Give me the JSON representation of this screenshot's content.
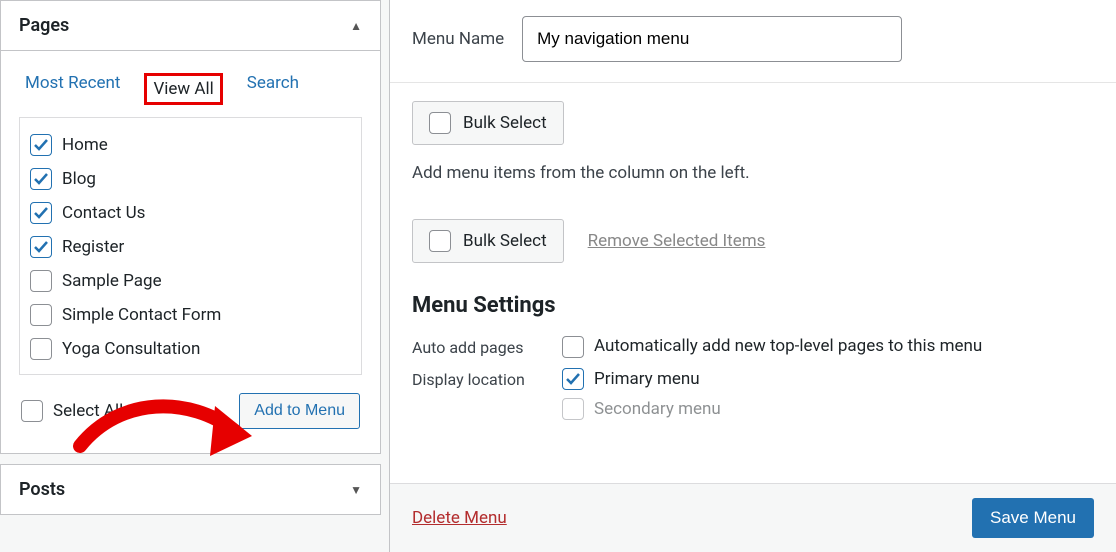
{
  "left": {
    "panels": {
      "pages": {
        "title": "Pages",
        "expanded": true
      },
      "posts": {
        "title": "Posts",
        "expanded": false
      }
    },
    "tabs": {
      "recent": "Most Recent",
      "view_all": "View All",
      "search": "Search",
      "active": "view_all"
    },
    "items": [
      {
        "label": "Home",
        "checked": true
      },
      {
        "label": "Blog",
        "checked": true
      },
      {
        "label": "Contact Us",
        "checked": true
      },
      {
        "label": "Register",
        "checked": true
      },
      {
        "label": "Sample Page",
        "checked": false
      },
      {
        "label": "Simple Contact Form",
        "checked": false
      },
      {
        "label": "Yoga Consultation",
        "checked": false
      }
    ],
    "select_all_label": "Select All",
    "add_button": "Add to Menu"
  },
  "right": {
    "menu_name_label": "Menu Name",
    "menu_name_value": "My navigation menu",
    "bulk_select_label": "Bulk Select",
    "hint": "Add menu items from the column on the left.",
    "remove_selected": "Remove Selected Items",
    "settings_heading": "Menu Settings",
    "auto_add": {
      "label": "Auto add pages",
      "option": "Automatically add new top-level pages to this menu",
      "checked": false
    },
    "display_location": {
      "label": "Display location",
      "options": [
        {
          "label": "Primary menu",
          "checked": true
        },
        {
          "label": "Secondary menu",
          "checked": false
        }
      ]
    },
    "delete_label": "Delete Menu",
    "save_label": "Save Menu"
  }
}
